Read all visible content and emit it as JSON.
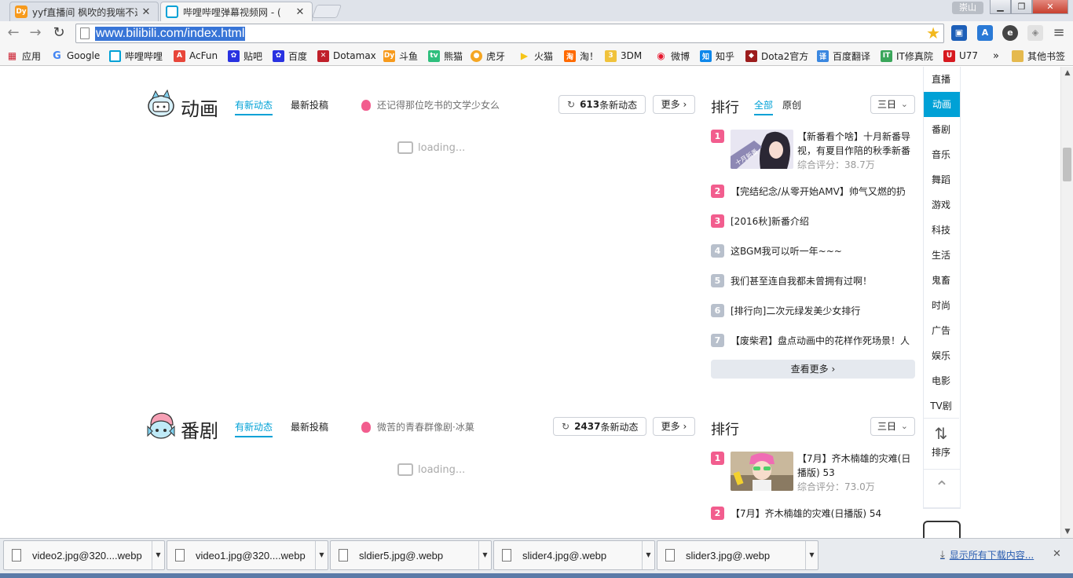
{
  "tabs": [
    {
      "title": "yyf直播间 枫吹的我喘不过",
      "favicon": "douyu-icon",
      "active": false
    },
    {
      "title": "哔哩哔哩弹幕视频网 - (",
      "favicon": "bilibili-tv-icon",
      "active": true
    }
  ],
  "profile_name": "崇山",
  "window_controls": {
    "minimize": "▁",
    "maximize": "❐",
    "close": "✕"
  },
  "address_bar": {
    "url": "www.bilibili.com/index.html"
  },
  "bookmarks": [
    {
      "label": "应用",
      "icon": "apps-grid-icon"
    },
    {
      "label": "Google",
      "icon": "google-icon"
    },
    {
      "label": "哔哩哔哩",
      "icon": "bilibili-icon"
    },
    {
      "label": "AcFun",
      "icon": "acfun-icon"
    },
    {
      "label": "贴吧",
      "icon": "paw-icon"
    },
    {
      "label": "百度",
      "icon": "paw-icon"
    },
    {
      "label": "Dotamax",
      "icon": "dotamax-icon"
    },
    {
      "label": "斗鱼",
      "icon": "douyu-icon"
    },
    {
      "label": "熊猫",
      "icon": "panda-tv-icon"
    },
    {
      "label": "虎牙",
      "icon": "huya-icon"
    },
    {
      "label": "火猫",
      "icon": "huomao-icon"
    },
    {
      "label": "淘！",
      "icon": "taobao-icon"
    },
    {
      "label": "3DM",
      "icon": "3dm-icon"
    },
    {
      "label": "微博",
      "icon": "weibo-icon"
    },
    {
      "label": "知乎",
      "icon": "zhihu-icon"
    },
    {
      "label": "Dota2官方",
      "icon": "dota2-icon"
    },
    {
      "label": "百度翻译",
      "icon": "translate-icon"
    },
    {
      "label": "IT修真院",
      "icon": "it-icon"
    },
    {
      "label": "U77",
      "icon": "u77-icon"
    }
  ],
  "bookmarks_overflow": "»",
  "other_bookmarks": "其他书签",
  "sections": [
    {
      "title": "动画",
      "tab_active": "有新动态",
      "tab_other": "最新投稿",
      "promo": "还记得那位吃书的文学少女么",
      "dynamic_count": "613",
      "dynamic_suffix": "条新动态",
      "more": "更多",
      "loading": "loading...",
      "rank_title": "排行",
      "rank_tabs": [
        "全部",
        "原创"
      ],
      "rank_period": "三日",
      "rank_first": {
        "num": "1",
        "title": "【新番看个啥】十月新番导视，有夏目作陪的秋季新番",
        "score": "综合评分：38.7万",
        "thumb_badge": "十月新番"
      },
      "rank_items": [
        {
          "num": "2",
          "title": "【完结纪念/从零开始AMV】帅气又燃的扔"
        },
        {
          "num": "3",
          "title": "[2016秋]新番介绍"
        },
        {
          "num": "4",
          "title": "这BGM我可以听一年~~~"
        },
        {
          "num": "5",
          "title": "我们甚至连自我都未曾拥有过啊！"
        },
        {
          "num": "6",
          "title": "[排行向]二次元绿发美少女排行"
        },
        {
          "num": "7",
          "title": "【废柴君】盘点动画中的花样作死场景！人"
        }
      ],
      "see_more": "查看更多"
    },
    {
      "title": "番剧",
      "tab_active": "有新动态",
      "tab_other": "最新投稿",
      "promo": "微苦的青春群像剧·冰菓",
      "dynamic_count": "2437",
      "dynamic_suffix": "条新动态",
      "more": "更多",
      "loading": "loading...",
      "rank_title": "排行",
      "rank_period": "三日",
      "rank_first": {
        "num": "1",
        "title": "【7月】齐木楠雄的灾难(日播版) 53",
        "score": "综合评分：73.0万"
      },
      "rank_items": [
        {
          "num": "2",
          "title": "【7月】齐木楠雄的灾难(日播版) 54"
        }
      ]
    }
  ],
  "side_nav": [
    "直播",
    "动画",
    "番剧",
    "音乐",
    "舞蹈",
    "游戏",
    "科技",
    "生活",
    "鬼畜",
    "时尚",
    "广告",
    "娱乐",
    "电影",
    "TV剧"
  ],
  "side_nav_active": "动画",
  "sort_label": "排序",
  "downloads": [
    {
      "name": "video2.jpg@320....webp"
    },
    {
      "name": "video1.jpg@320....webp"
    },
    {
      "name": "sldier5.jpg@.webp"
    },
    {
      "name": "slider4.jpg@.webp"
    },
    {
      "name": "slider3.jpg@.webp"
    }
  ],
  "show_all_downloads": "显示所有下载内容...",
  "colors": {
    "accent": "#00a1d6",
    "rank_pink": "#f25d8e",
    "rank_gray": "#b8c0cc"
  }
}
